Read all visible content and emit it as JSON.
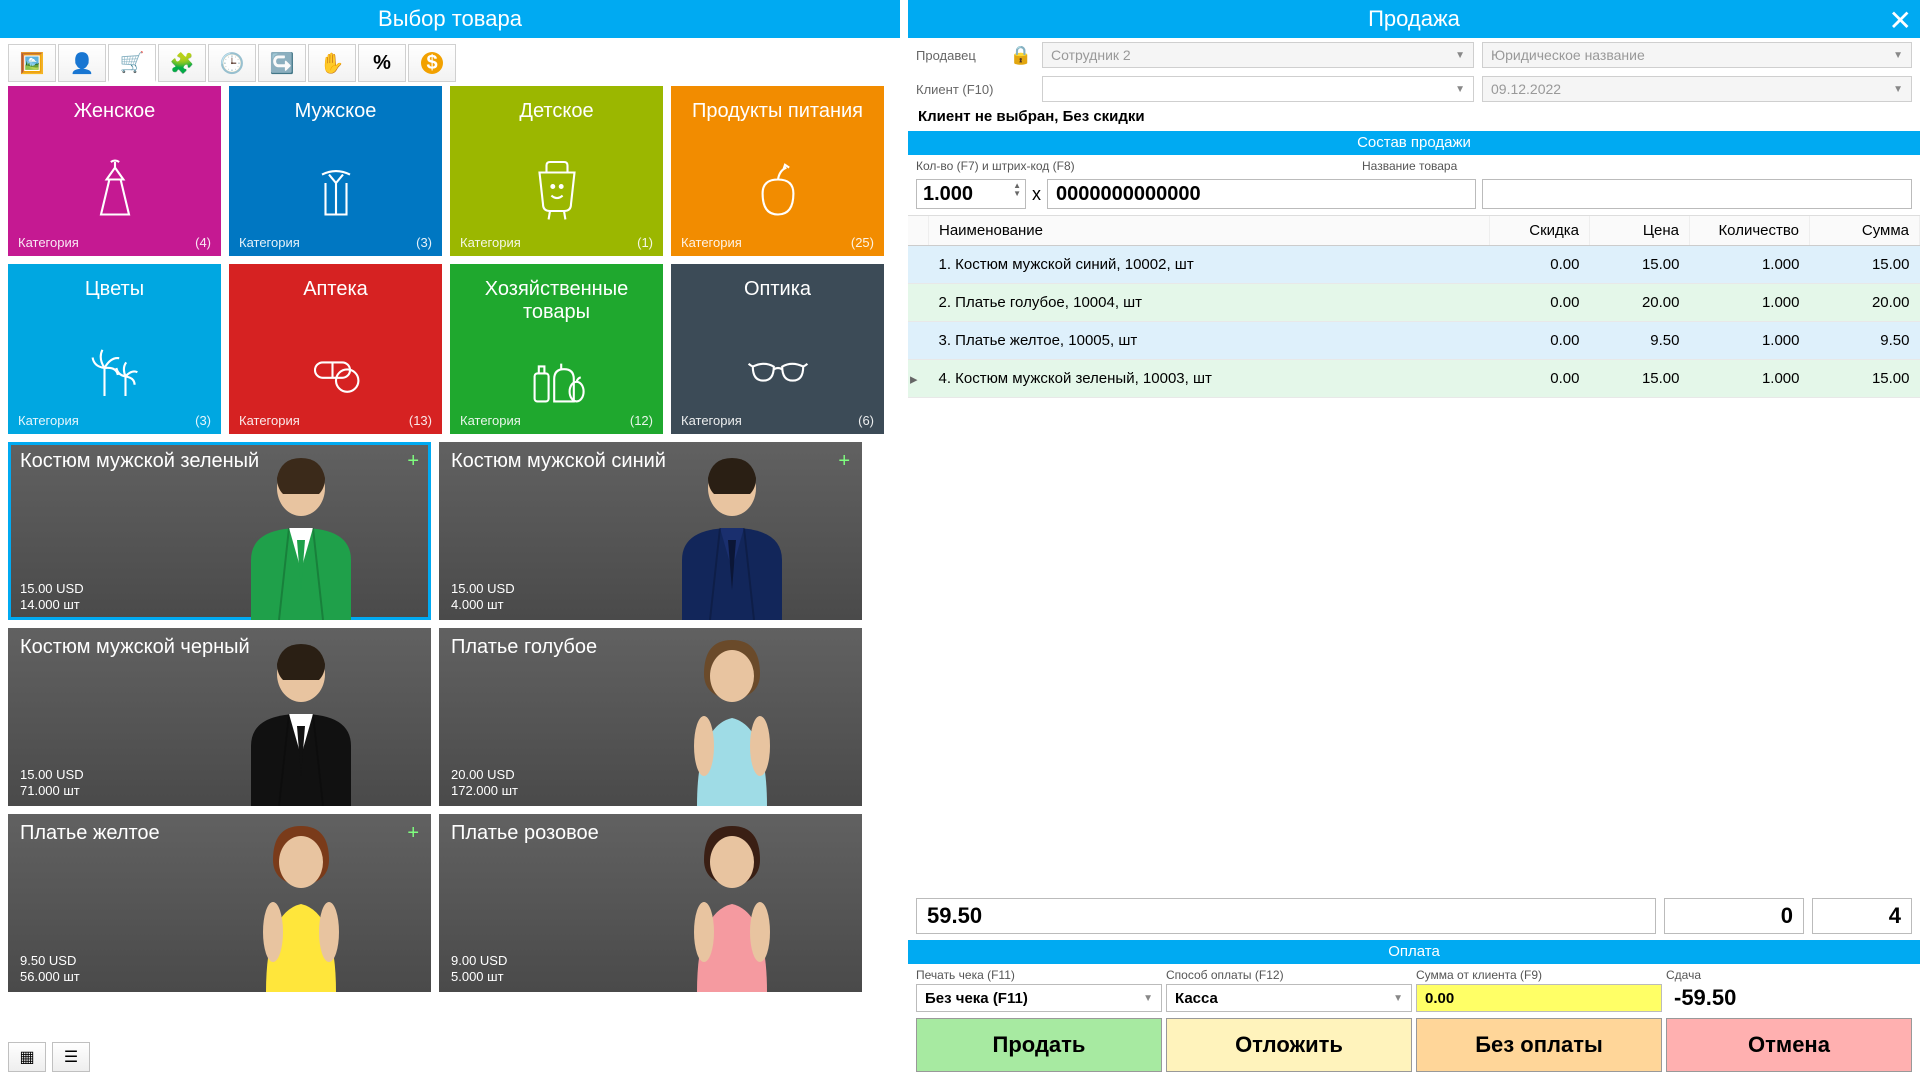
{
  "left": {
    "title": "Выбор товара",
    "categories": [
      {
        "name": "Женское",
        "label": "Категория",
        "count": "(4)",
        "color": "#c51992"
      },
      {
        "name": "Мужское",
        "label": "Категория",
        "count": "(3)",
        "color": "#0077c2"
      },
      {
        "name": "Детское",
        "label": "Категория",
        "count": "(1)",
        "color": "#9bb700"
      },
      {
        "name": "Продукты питания",
        "label": "Категория",
        "count": "(25)",
        "color": "#f28c00"
      },
      {
        "name": "Цветы",
        "label": "Категория",
        "count": "(3)",
        "color": "#00a7e1"
      },
      {
        "name": "Аптека",
        "label": "Категория",
        "count": "(13)",
        "color": "#d62222"
      },
      {
        "name": "Хозяйственные товары",
        "label": "Категория",
        "count": "(12)",
        "color": "#1fa82e"
      },
      {
        "name": "Оптика",
        "label": "Категория",
        "count": "(6)",
        "color": "#3c4b57"
      }
    ],
    "products": [
      {
        "name": "Костюм мужской зеленый",
        "price": "15.00 USD",
        "stock": "14.000 шт",
        "plus": true,
        "sel": true,
        "suit": "#1fa04a",
        "shirt": "#fff",
        "tie": "#1fa04a",
        "hair": "#3b2a1a"
      },
      {
        "name": "Костюм мужской синий",
        "price": "15.00 USD",
        "stock": "4.000 шт",
        "plus": true,
        "suit": "#12265a",
        "shirt": "#1a2f6e",
        "tie": "#0b1636",
        "hair": "#2a1f14"
      },
      {
        "name": "Костюм мужской черный",
        "price": "15.00 USD",
        "stock": "71.000 шт",
        "suit": "#111",
        "shirt": "#fff",
        "tie": "#111",
        "hair": "#2a1f14"
      },
      {
        "name": "Платье голубое",
        "price": "20.00 USD",
        "stock": "172.000 шт",
        "dress": "#9fdce6",
        "hair": "#6a4a2a"
      },
      {
        "name": "Платье желтое",
        "price": "9.50 USD",
        "stock": "56.000 шт",
        "plus": true,
        "dress": "#ffe63b",
        "hair": "#7a3b1a"
      },
      {
        "name": "Платье розовое",
        "price": "9.00 USD",
        "stock": "5.000 шт",
        "dress": "#f59aa0",
        "hair": "#3a1f14"
      }
    ]
  },
  "right": {
    "title": "Продажа",
    "seller_label": "Продавец",
    "seller_value": "Сотрудник 2",
    "legal_value": "Юридическое название",
    "client_label": "Клиент (F10)",
    "date_value": "09.12.2022",
    "info": "Клиент не выбран, Без скидки",
    "section1": "Состав продажи",
    "qty_label": "Кол-во (F7) и штрих-код (F8)",
    "name_label": "Название товара",
    "qty_value": "1.000",
    "x": "x",
    "barcode_value": "0000000000000",
    "columns": {
      "c1": "Наименование",
      "c2": "Скидка",
      "c3": "Цена",
      "c4": "Количество",
      "c5": "Сумма"
    },
    "rows": [
      {
        "n": "1. Костюм мужской синий, 10002, шт",
        "d": "0.00",
        "p": "15.00",
        "q": "1.000",
        "s": "15.00",
        "cls": "r-blue"
      },
      {
        "n": "2. Платье голубое, 10004, шт",
        "d": "0.00",
        "p": "20.00",
        "q": "1.000",
        "s": "20.00",
        "cls": "r-green"
      },
      {
        "n": "3. Платье желтое, 10005, шт",
        "d": "0.00",
        "p": "9.50",
        "q": "1.000",
        "s": "9.50",
        "cls": "r-blue"
      },
      {
        "n": "4. Костюм мужской зеленый, 10003, шт",
        "d": "0.00",
        "p": "15.00",
        "q": "1.000",
        "s": "15.00",
        "cls": "r-green",
        "arrow": true
      }
    ],
    "totals": {
      "sum": "59.50",
      "mid": "0",
      "count": "4"
    },
    "section2": "Оплата",
    "receipt_label": "Печать чека (F11)",
    "receipt_value": "Без чека (F11)",
    "method_label": "Способ оплаты (F12)",
    "method_value": "Касса",
    "client_sum_label": "Сумма от клиента (F9)",
    "client_sum_value": "0.00",
    "change_label": "Сдача",
    "change_value": "-59.50",
    "buttons": {
      "sell": "Продать",
      "defer": "Отложить",
      "nopay": "Без оплаты",
      "cancel": "Отмена"
    }
  }
}
